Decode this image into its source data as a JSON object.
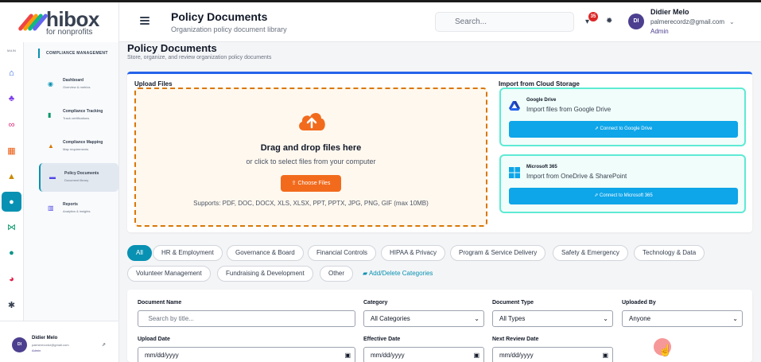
{
  "brand": {
    "name": "hibox",
    "tagline": "for nonprofits"
  },
  "header": {
    "title": "Policy Documents",
    "subtitle": "Organization policy document library",
    "search_placeholder": "Search...",
    "notification_count": "35",
    "user": {
      "initials": "DI",
      "name": "Didier Melo",
      "email": "palmerecordz@gmail.com",
      "role": "Admin"
    }
  },
  "rail": {
    "label": "MAIN",
    "items": [
      {
        "icon": "home-icon",
        "glyph": "⌂",
        "color": "#2563eb",
        "active": false
      },
      {
        "icon": "org-chart-icon",
        "glyph": "♣",
        "color": "#7c3aed",
        "active": false
      },
      {
        "icon": "link-icon",
        "glyph": "∞",
        "color": "#db2777",
        "active": false
      },
      {
        "icon": "building-icon",
        "glyph": "▦",
        "color": "#ea580c",
        "active": false
      },
      {
        "icon": "graduation-cap-icon",
        "glyph": "▲",
        "color": "#ca8a04",
        "active": false
      },
      {
        "icon": "shield-icon",
        "glyph": "●",
        "color": "#ffffff",
        "active": true
      },
      {
        "icon": "network-icon",
        "glyph": "⋈",
        "color": "#059669",
        "active": false
      },
      {
        "icon": "users-icon",
        "glyph": "●",
        "color": "#0d9488",
        "active": false
      },
      {
        "icon": "pie-chart-icon",
        "glyph": "◕",
        "color": "#e11d48",
        "active": false
      },
      {
        "icon": "gear-icon",
        "glyph": "✱",
        "color": "#374151",
        "active": false
      }
    ]
  },
  "sidebar": {
    "section": "COMPLIANCE MANAGEMENT",
    "items": [
      {
        "label": "Dashboard",
        "desc": "Overview & metrics",
        "icon": "gauge-icon",
        "glyph": "◉",
        "color": "#0891b2",
        "active": false
      },
      {
        "label": "Compliance Tracking",
        "desc": "Track certifications",
        "icon": "clipboard-icon",
        "glyph": "▮",
        "color": "#059669",
        "active": false
      },
      {
        "label": "Compliance Mapping",
        "desc": "Map requirements",
        "icon": "map-icon",
        "glyph": "▲",
        "color": "#d97706",
        "active": false
      },
      {
        "label": "Policy Documents",
        "desc": "Document library",
        "icon": "folder-icon",
        "glyph": "▬",
        "color": "#4f46e5",
        "active": true
      },
      {
        "label": "Reports",
        "desc": "Analytics & insights",
        "icon": "chart-icon",
        "glyph": "▥",
        "color": "#4f46e5",
        "active": false
      }
    ],
    "user": {
      "initials": "DI",
      "name": "Didier Melo",
      "email": "palmerecordz@gmail.com",
      "role": "Admin"
    }
  },
  "page": {
    "title": "Policy Documents",
    "subtitle": "Store, organize, and review organization policy documents"
  },
  "upload": {
    "title": "Upload Files",
    "drop_title": "Drag and drop files here",
    "drop_sub": "or click to select files from your computer",
    "choose_label": "Choose Files",
    "supports": "Supports: PDF, DOC, DOCX, XLS, XLSX, PPT, PPTX, JPG, PNG, GIF (max 10MB)"
  },
  "cloud": {
    "title": "Import from Cloud Storage",
    "providers": [
      {
        "name": "Google Drive",
        "desc": "Import files from Google Drive",
        "button": "Connect to Google Drive"
      },
      {
        "name": "Microsoft 365",
        "desc": "Import from OneDrive & SharePoint",
        "button": "Connect to Microsoft 365"
      }
    ]
  },
  "categories": {
    "items": [
      "All",
      "HR & Employment",
      "Governance & Board",
      "Financial Controls",
      "HIPAA & Privacy",
      "Program & Service Delivery",
      "Safety & Emergency",
      "Technology & Data",
      "Volunteer Management",
      "Fundraising & Development",
      "Other"
    ],
    "active": "All",
    "manage_label": "Add/Delete Categories"
  },
  "filters": {
    "document_name": {
      "label": "Document Name",
      "placeholder": "Search by title..."
    },
    "category": {
      "label": "Category",
      "value": "All Categories"
    },
    "document_type": {
      "label": "Document Type",
      "value": "All Types"
    },
    "uploaded_by": {
      "label": "Uploaded By",
      "value": "Anyone"
    },
    "upload_date": {
      "label": "Upload Date",
      "value": "mm/dd/yyyy"
    },
    "effective_date": {
      "label": "Effective Date",
      "value": "mm/dd/yyyy"
    },
    "next_review_date": {
      "label": "Next Review Date",
      "value": "mm/dd/yyyy"
    }
  },
  "colors": {
    "accent": "#0891b2",
    "orange": "#f26b1d",
    "cloud_button": "#0ea5e9"
  }
}
